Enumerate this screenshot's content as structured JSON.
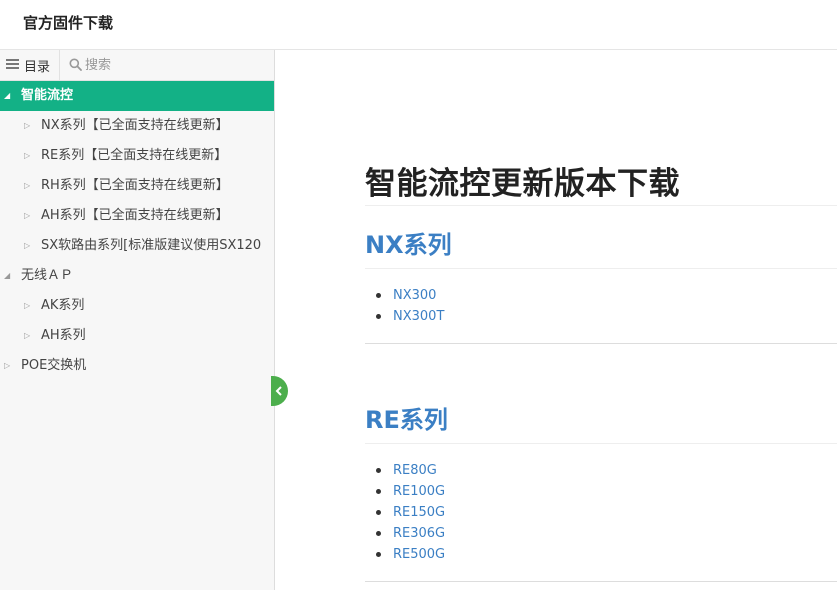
{
  "header": {
    "title": "官方固件下载"
  },
  "sidebar": {
    "toc_label": "目录",
    "search_placeholder": "搜索",
    "items": [
      {
        "label": "智能流控",
        "level": 0,
        "expanded": true,
        "active": true
      },
      {
        "label": "NX系列【已全面支持在线更新】",
        "level": 1,
        "expanded": false,
        "active": false
      },
      {
        "label": "RE系列【已全面支持在线更新】",
        "level": 1,
        "expanded": false,
        "active": false
      },
      {
        "label": "RH系列【已全面支持在线更新】",
        "level": 1,
        "expanded": false,
        "active": false
      },
      {
        "label": "AH系列【已全面支持在线更新】",
        "level": 1,
        "expanded": false,
        "active": false
      },
      {
        "label": "SX软路由系列[标准版建议使用SX120",
        "level": 1,
        "expanded": false,
        "active": false
      },
      {
        "label": "无线ＡＰ",
        "level": 0,
        "expanded": true,
        "active": false
      },
      {
        "label": "AK系列",
        "level": 1,
        "expanded": false,
        "active": false
      },
      {
        "label": "AH系列",
        "level": 1,
        "expanded": false,
        "active": false
      },
      {
        "label": "POE交换机",
        "level": 0,
        "expanded": false,
        "active": false
      }
    ]
  },
  "main": {
    "page_title": "智能流控更新版本下载",
    "sections": [
      {
        "heading": "NX系列",
        "links": [
          "NX300",
          "NX300T"
        ]
      },
      {
        "heading": "RE系列",
        "links": [
          "RE80G",
          "RE100G",
          "RE150G",
          "RE306G",
          "RE500G"
        ]
      }
    ]
  },
  "colors": {
    "active_item_bg": "#13b186",
    "link": "#3b7fc4",
    "collapse_button": "#4cae4c"
  },
  "icons": {
    "toc": "menu-icon",
    "search": "search-icon",
    "tree_expanded": "triangle-down-icon",
    "tree_collapsed": "triangle-right-icon",
    "collapse": "chevron-left-icon"
  }
}
